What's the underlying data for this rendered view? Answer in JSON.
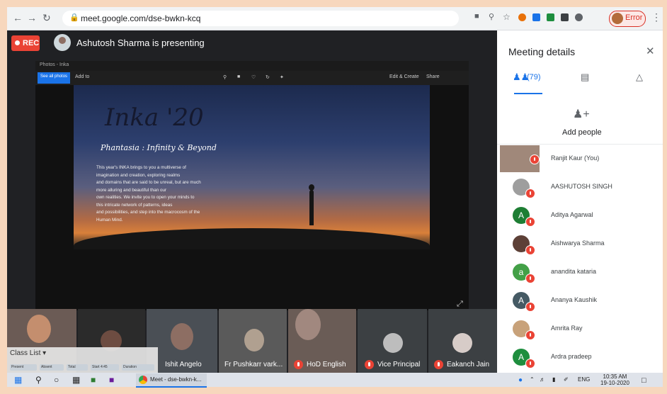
{
  "browser": {
    "url": "meet.google.com/dse-bwkn-kcq",
    "error_label": "Error"
  },
  "meeting": {
    "rec_label": "REC",
    "presenting_text": "Ashutosh Sharma is presenting"
  },
  "shared_window": {
    "title": "Photos - Inka",
    "toolbar_button": "See all photos",
    "toolbar_add": "Add to",
    "toolbar_right": [
      "Edit & Create",
      "Share"
    ]
  },
  "slide": {
    "title": "Inka '20",
    "subtitle": "Phantasia : Infinity & Beyond",
    "body_lines": [
      "This year's INKA brings to you a multiverse of",
      "imagination and creation, exploring realms",
      "and domains that are said to be unreal, but are much",
      "more alluring and beautiful than our",
      "own realities. We invite you to open your minds to",
      "this intricate network of patterns, ideas",
      "and possibilities, and step into the macrocosm of the",
      "Human Mind."
    ]
  },
  "tiles": [
    {
      "name": ""
    },
    {
      "name": "Ishit Angelo"
    },
    {
      "name": "Fr Pushkarr vark..."
    },
    {
      "name": "HoD English"
    },
    {
      "name": "Vice Principal"
    },
    {
      "name": "Eakanch Jain"
    }
  ],
  "class_list": {
    "header": "Class List",
    "chips": [
      "Present",
      "Absent",
      "Total",
      "Start 4:45",
      "Duration"
    ]
  },
  "panel": {
    "title": "Meeting details",
    "people_count": "(79)",
    "add_people": "Add people",
    "participants": [
      {
        "name": "Ranjit Kaur (You)",
        "initial": "",
        "color": "#a0887a"
      },
      {
        "name": "AASHUTOSH SINGH",
        "initial": "",
        "color": "#9e9e9e"
      },
      {
        "name": "Aditya Agarwal",
        "initial": "A",
        "color": "#1e7e34"
      },
      {
        "name": "Aishwarya Sharma",
        "initial": "",
        "color": "#5d4037"
      },
      {
        "name": "anandita kataria",
        "initial": "a",
        "color": "#43a047"
      },
      {
        "name": "Ananya Kaushik",
        "initial": "A",
        "color": "#455a64"
      },
      {
        "name": "Amrita Ray",
        "initial": "",
        "color": "#c8a27a"
      },
      {
        "name": "Ardra pradeep",
        "initial": "A",
        "color": "#1e8e3e"
      }
    ]
  },
  "taskbar": {
    "chrome_label": "Meet - dse-bwkn-k...",
    "lang": "ENG",
    "time": "10:35 AM",
    "date": "19-10-2020"
  }
}
